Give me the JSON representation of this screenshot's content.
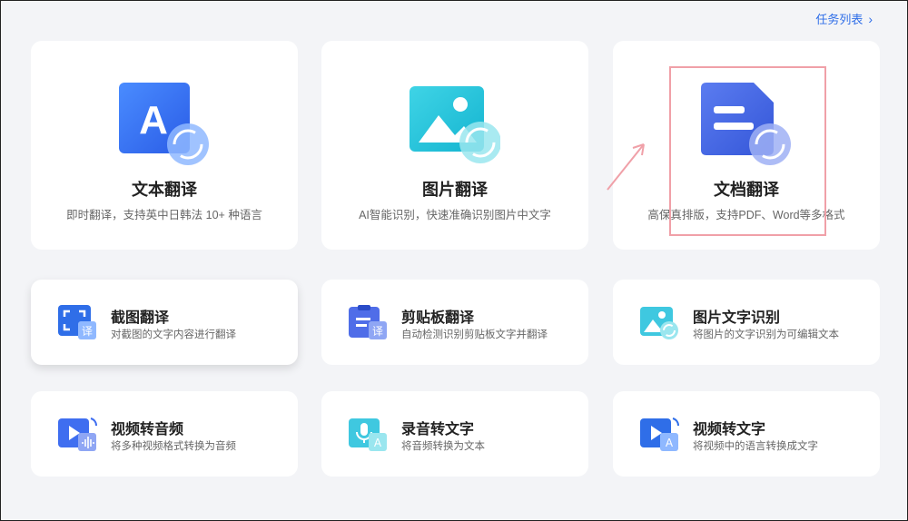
{
  "header": {
    "task_list_label": "任务列表"
  },
  "big_cards": [
    {
      "title": "文本翻译",
      "desc": "即时翻译，支持英中日韩法 10+ 种语言",
      "icon": "text-translate-icon",
      "glyph": "A"
    },
    {
      "title": "图片翻译",
      "desc": "AI智能识别，快速准确识别图片中文字",
      "icon": "image-translate-icon"
    },
    {
      "title": "文档翻译",
      "desc": "高保真排版，支持PDF、Word等多格式",
      "icon": "document-translate-icon"
    }
  ],
  "small_cards": [
    {
      "title": "截图翻译",
      "desc": "对截图的文字内容进行翻译",
      "icon": "screenshot-translate-icon",
      "badge": "译"
    },
    {
      "title": "剪贴板翻译",
      "desc": "自动检测识别剪贴板文字并翻译",
      "icon": "clipboard-translate-icon",
      "badge": "译"
    },
    {
      "title": "图片文字识别",
      "desc": "将图片的文字识别为可编辑文本",
      "icon": "image-ocr-icon"
    },
    {
      "title": "视频转音频",
      "desc": "将多种视频格式转换为音频",
      "icon": "video-to-audio-icon"
    },
    {
      "title": "录音转文字",
      "desc": "将音频转换为文本",
      "icon": "audio-to-text-icon",
      "badge": "A"
    },
    {
      "title": "视频转文字",
      "desc": "将视频中的语言转换成文字",
      "icon": "video-to-text-icon",
      "badge": "A"
    }
  ],
  "colors": {
    "accent": "#2f6ee8",
    "highlight_box": "#f0a0a8"
  }
}
